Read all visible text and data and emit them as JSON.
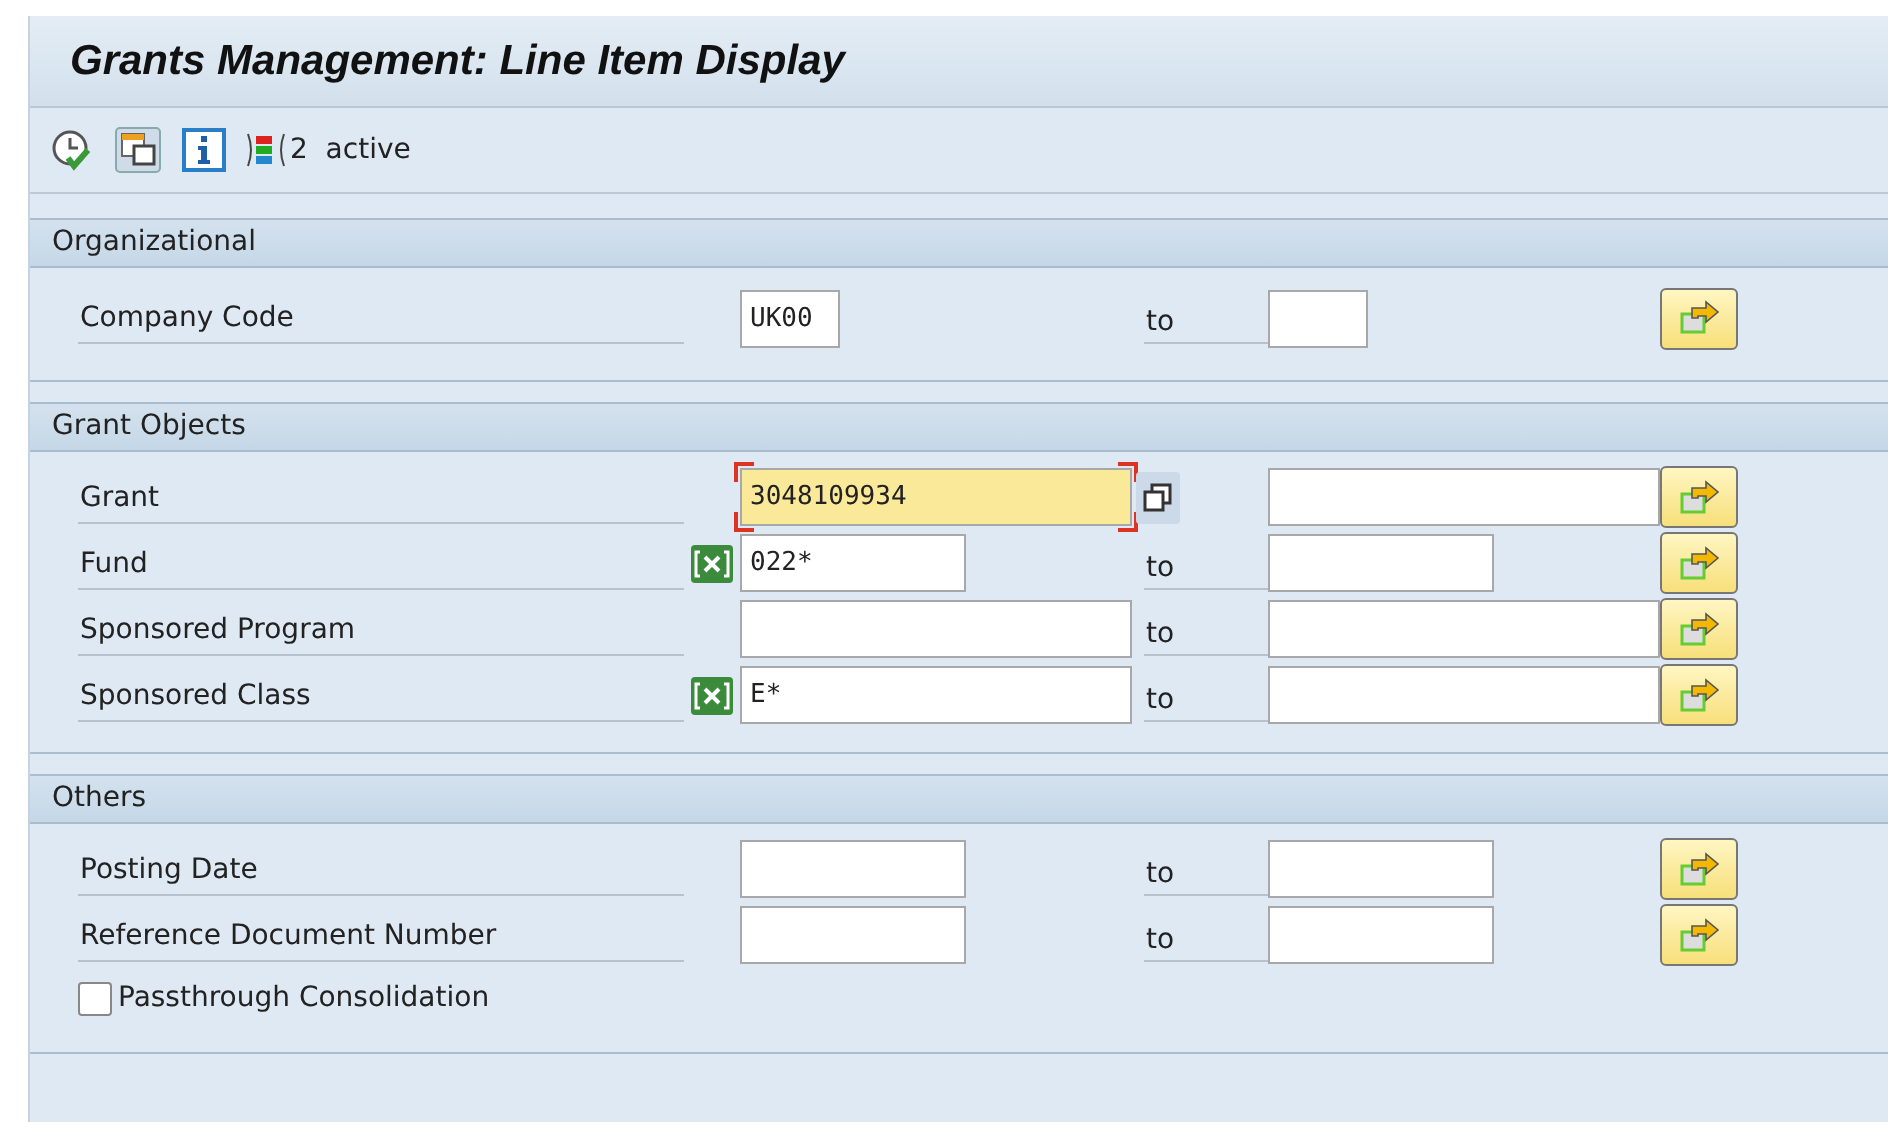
{
  "window": {
    "title": "Grants Management: Line Item Display"
  },
  "toolbar": {
    "status": "2  active"
  },
  "sections": [
    {
      "title": "Organizational",
      "rows": [
        {
          "kind": "range",
          "label": "Company Code",
          "excluded": false,
          "low": {
            "value": "UK00",
            "focused": false
          },
          "to": "to"
        }
      ]
    },
    {
      "title": "Grant Objects",
      "rows": [
        {
          "kind": "single",
          "label": "Grant",
          "excluded": false,
          "low": {
            "value": "3048109934",
            "focused": true
          }
        },
        {
          "kind": "range",
          "label": "Fund",
          "excluded": true,
          "low": {
            "value": "022*",
            "focused": false
          },
          "to": "to"
        },
        {
          "kind": "range",
          "label": "Sponsored Program",
          "excluded": false,
          "low": {
            "focused": false
          },
          "to": "to"
        },
        {
          "kind": "range",
          "label": "Sponsored Class",
          "excluded": true,
          "low": {
            "value": "E*",
            "focused": false
          },
          "to": "to"
        }
      ]
    },
    {
      "title": "Others",
      "rows": [
        {
          "kind": "range",
          "label": "Posting Date",
          "excluded": false,
          "low": {
            "focused": false
          },
          "to": "to"
        },
        {
          "kind": "range",
          "label": "Reference Document Number",
          "excluded": false,
          "low": {
            "focused": false
          },
          "to": "to"
        },
        {
          "kind": "checkbox",
          "label": "Passthrough Consolidation",
          "checked": false
        }
      ]
    }
  ]
}
